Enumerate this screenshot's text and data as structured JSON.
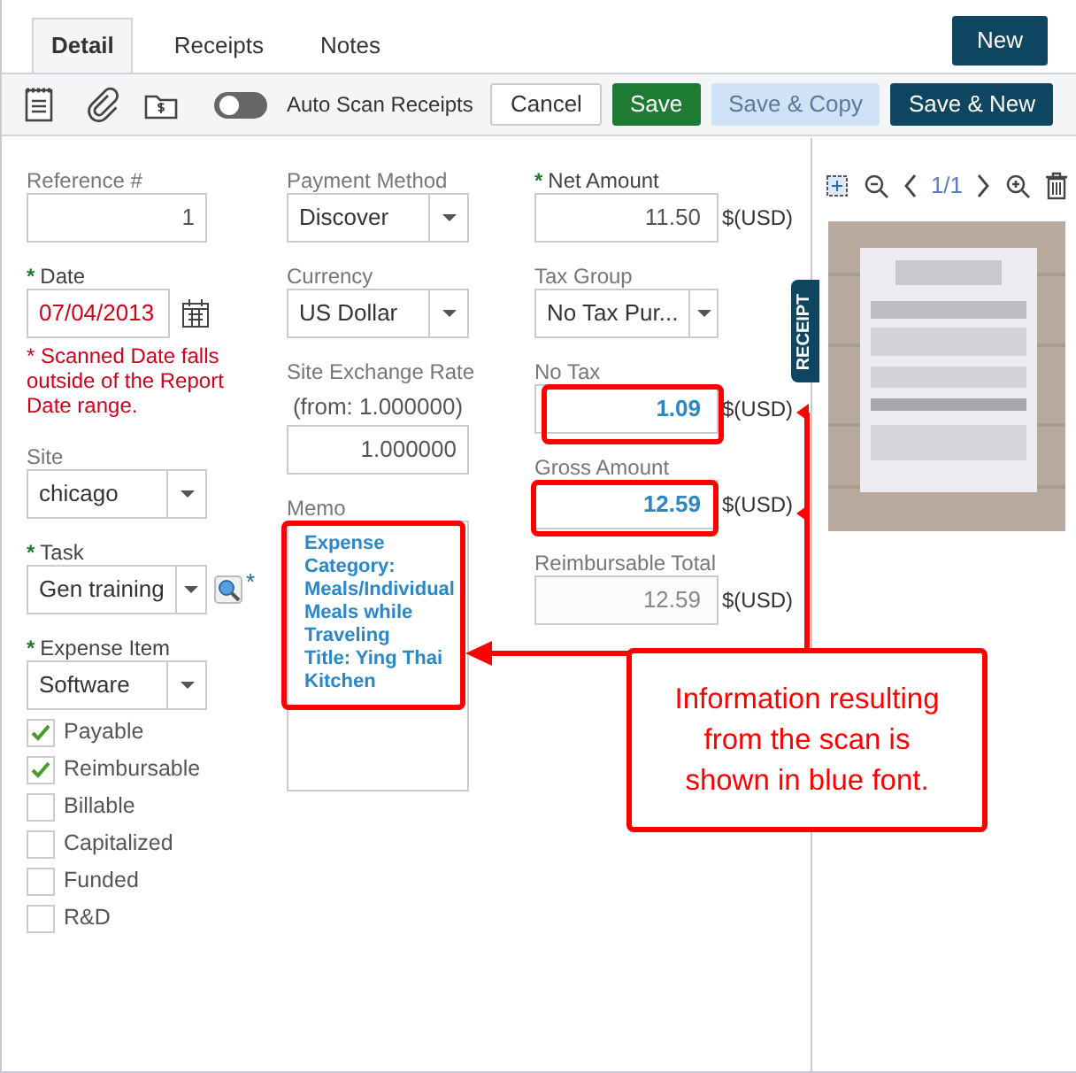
{
  "tabs": [
    {
      "label": "Detail",
      "selected": true
    },
    {
      "label": "Receipts",
      "selected": false
    },
    {
      "label": "Notes",
      "selected": false
    }
  ],
  "new_button": "New",
  "toolbar": {
    "auto_scan": {
      "label": "Auto Scan Receipts",
      "on": false
    },
    "buttons": [
      {
        "label": "Cancel",
        "kind": "default"
      },
      {
        "label": "Save",
        "kind": "primary"
      },
      {
        "label": "Save & Copy",
        "kind": "disabled"
      },
      {
        "label": "Save & New",
        "kind": "dark"
      }
    ]
  },
  "columns": [
    [
      {
        "kind": "text",
        "label": "Reference #",
        "value": "1"
      },
      {
        "kind": "date",
        "label": "Date",
        "marker": "*",
        "value": "07/04/2013",
        "error": true
      },
      {
        "kind": "warning",
        "text": "* Scanned Date falls outside of the Report Date range."
      },
      {
        "kind": "select",
        "label": "Site",
        "value": "chicago"
      },
      {
        "kind": "lookup",
        "label": "Task",
        "value": "Gen training",
        "marker": "*"
      },
      {
        "kind": "select",
        "label": "Expense Item",
        "marker": "*",
        "value": "Software"
      },
      {
        "kind": "checkbox",
        "label": "Payable",
        "checked": true
      },
      {
        "kind": "checkbox",
        "label": "Reimbursable",
        "checked": true
      },
      {
        "kind": "checkbox",
        "label": "Billable",
        "checked": false
      },
      {
        "kind": "checkbox",
        "label": "Capitalized",
        "checked": false
      },
      {
        "kind": "checkbox",
        "label": "Funded",
        "checked": false
      },
      {
        "kind": "checkbox",
        "label": "R&D",
        "checked": false
      }
    ],
    [
      {
        "kind": "select",
        "label": "Payment Method",
        "value": "Discover"
      },
      {
        "kind": "select",
        "label": "Currency",
        "value": "US Dollar"
      },
      {
        "kind": "rate",
        "label": "Site Exchange Rate",
        "hint": "(from: 1.000000)",
        "value": "1.000000"
      },
      {
        "kind": "memo",
        "label": "Memo",
        "value": "Expense Category: Meals/Individual Meals while Traveling\nTitle: Ying Thai Kitchen",
        "scanned": true
      }
    ],
    [
      {
        "kind": "money",
        "label": "Net Amount",
        "marker": "*",
        "value": "11.50",
        "unit": "$(USD)",
        "scanned": false,
        "disabled": false
      },
      {
        "kind": "select",
        "label": "Tax Group",
        "value": "No Tax Pur..."
      },
      {
        "kind": "money",
        "label": "No Tax",
        "value": "1.09",
        "unit": "$(USD)",
        "scanned": true,
        "disabled": false
      },
      {
        "kind": "money",
        "label": "Gross Amount",
        "value": "12.59",
        "unit": "$(USD)",
        "scanned": true,
        "disabled": false
      },
      {
        "kind": "money",
        "label": "Reimbursable Total",
        "value": "12.59",
        "unit": "$(USD)",
        "scanned": false,
        "disabled": true
      }
    ]
  ],
  "receipt_panel": {
    "tab": "RECEIPT",
    "pager": "1/1"
  },
  "callout": {
    "text": "Information resulting from the scan is shown in blue font."
  }
}
